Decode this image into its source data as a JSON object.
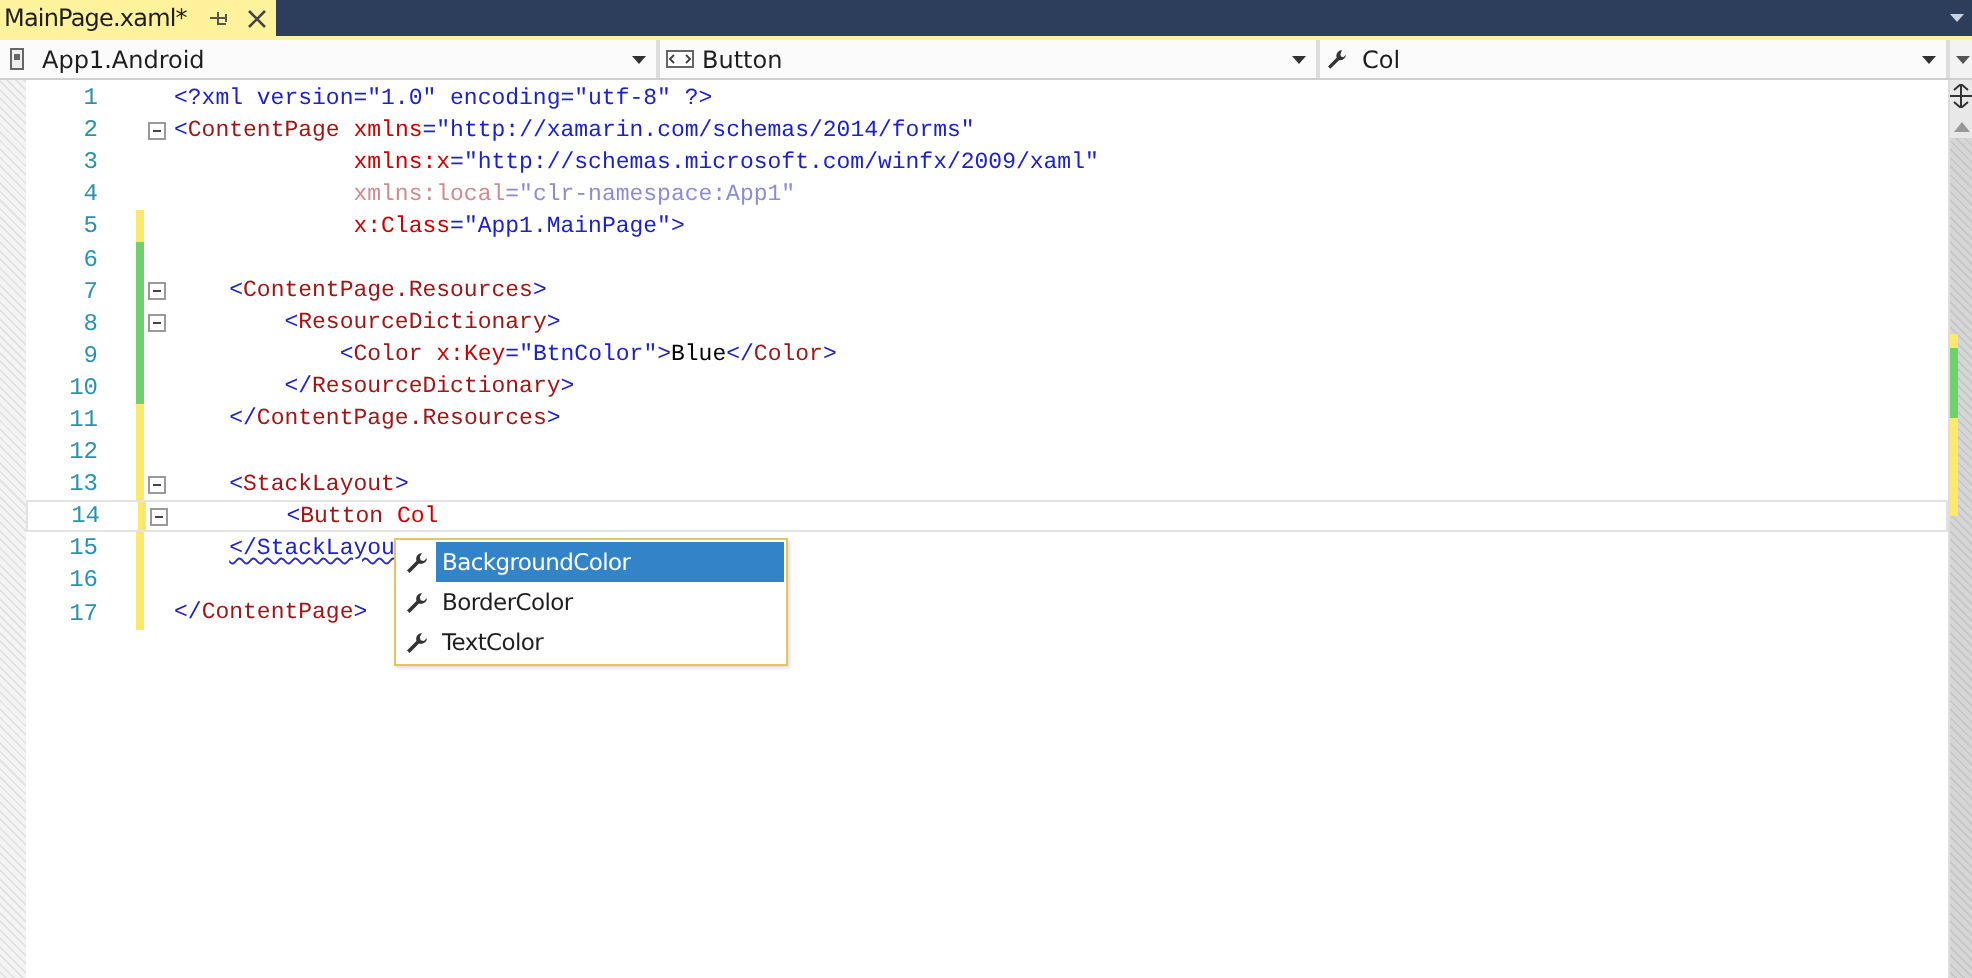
{
  "tabs": [
    {
      "label": "MainPage.xaml*",
      "selected": true
    }
  ],
  "nav_bar": [
    {
      "kind": "project",
      "text": "App1.Android"
    },
    {
      "kind": "type",
      "text": "Button"
    },
    {
      "kind": "member",
      "text": "Col"
    }
  ],
  "editor": {
    "lines": [
      {
        "number": "1",
        "modified": false,
        "fold": false,
        "current": false,
        "tokens": [
          {
            "kind": "delim",
            "text": "<?xml version=\"1.0\" encoding=\"utf-8\" ?>"
          }
        ]
      },
      {
        "number": "2",
        "modified": false,
        "fold": true,
        "current": false,
        "tokens": [
          {
            "kind": "delim",
            "text": "<"
          },
          {
            "kind": "elem",
            "text": "ContentPage"
          },
          {
            "kind": "attr",
            "text": " xmlns"
          },
          {
            "kind": "delim",
            "text": "="
          },
          {
            "kind": "value",
            "text": "\"http://xamarin.com/schemas/2014/forms\""
          }
        ]
      },
      {
        "number": "3",
        "modified": false,
        "fold": false,
        "current": false,
        "tokens": [
          {
            "kind": "attr",
            "text": "             xmlns:x"
          },
          {
            "kind": "delim",
            "text": "="
          },
          {
            "kind": "value",
            "text": "\"http://schemas.microsoft.com/winfx/2009/xaml\""
          }
        ]
      },
      {
        "number": "4",
        "modified": false,
        "fold": false,
        "current": false,
        "tokens": [
          {
            "kind": "faded-attr",
            "text": "             xmlns:local"
          },
          {
            "kind": "faded",
            "text": "=\"clr-namespace:App1\""
          }
        ]
      },
      {
        "number": "5",
        "modified": true,
        "saved": false,
        "fold": false,
        "current": false,
        "tokens": [
          {
            "kind": "attr",
            "text": "             x:Class"
          },
          {
            "kind": "delim",
            "text": "="
          },
          {
            "kind": "value",
            "text": "\"App1.MainPage\""
          },
          {
            "kind": "delim",
            "text": ">"
          }
        ]
      },
      {
        "number": "6",
        "modified": true,
        "saved": true,
        "fold": false,
        "current": false
      },
      {
        "number": "7",
        "modified": true,
        "saved": true,
        "fold": true,
        "current": false,
        "tokens": [
          {
            "kind": "delim",
            "text": "    <"
          },
          {
            "kind": "elem",
            "text": "ContentPage.Resources"
          },
          {
            "kind": "delim",
            "text": ">"
          }
        ]
      },
      {
        "number": "8",
        "modified": true,
        "saved": true,
        "fold": true,
        "current": false,
        "tokens": [
          {
            "kind": "delim",
            "text": "        <"
          },
          {
            "kind": "elem",
            "text": "ResourceDictionary"
          },
          {
            "kind": "delim",
            "text": ">"
          }
        ]
      },
      {
        "number": "9",
        "modified": true,
        "saved": true,
        "fold": false,
        "current": false,
        "tokens": [
          {
            "kind": "delim",
            "text": "            <"
          },
          {
            "kind": "elem",
            "text": "Color"
          },
          {
            "kind": "attr",
            "text": " x:Key"
          },
          {
            "kind": "delim",
            "text": "="
          },
          {
            "kind": "value",
            "text": "\"BtnColor\""
          },
          {
            "kind": "delim",
            "text": ">"
          },
          {
            "kind": "text",
            "text": "Blue"
          },
          {
            "kind": "delim",
            "text": "</"
          },
          {
            "kind": "elem",
            "text": "Color"
          },
          {
            "kind": "delim",
            "text": ">"
          }
        ]
      },
      {
        "number": "10",
        "modified": true,
        "saved": true,
        "fold": false,
        "current": false,
        "tokens": [
          {
            "kind": "delim",
            "text": "        </"
          },
          {
            "kind": "elem",
            "text": "ResourceDictionary"
          },
          {
            "kind": "delim",
            "text": ">"
          }
        ]
      },
      {
        "number": "11",
        "modified": true,
        "saved": false,
        "fold": false,
        "current": false,
        "tokens": [
          {
            "kind": "delim",
            "text": "    </"
          },
          {
            "kind": "elem",
            "text": "ContentPage.Resources"
          },
          {
            "kind": "delim",
            "text": ">"
          }
        ]
      },
      {
        "number": "12",
        "modified": true,
        "saved": false,
        "fold": false,
        "current": false
      },
      {
        "number": "13",
        "modified": true,
        "saved": false,
        "fold": true,
        "current": false,
        "tokens": [
          {
            "kind": "delim",
            "text": "    <"
          },
          {
            "kind": "elem",
            "text": "StackLayout"
          },
          {
            "kind": "delim",
            "text": ">"
          }
        ]
      },
      {
        "number": "14",
        "modified": true,
        "saved": false,
        "fold": true,
        "current": true,
        "tokens": [
          {
            "kind": "delim",
            "text": "        <"
          },
          {
            "kind": "elem",
            "text": "Button"
          },
          {
            "kind": "attr",
            "text": " Col"
          }
        ]
      },
      {
        "number": "15",
        "modified": true,
        "saved": false,
        "fold": false,
        "current": false,
        "tokens": [
          {
            "kind": "error",
            "text": "    </StackLayou"
          }
        ]
      },
      {
        "number": "16",
        "modified": true,
        "saved": false,
        "fold": false,
        "current": false
      },
      {
        "number": "17",
        "modified": true,
        "saved": false,
        "fold": false,
        "current": false,
        "tokens": [
          {
            "kind": "delim",
            "text": "</"
          },
          {
            "kind": "elem",
            "text": "ContentPage"
          },
          {
            "kind": "delim",
            "text": ">"
          }
        ]
      }
    ]
  },
  "completion": {
    "items": [
      {
        "text": "BackgroundColor",
        "selected": true
      },
      {
        "text": "BorderColor",
        "selected": false
      },
      {
        "text": "TextColor",
        "selected": false
      }
    ]
  }
}
